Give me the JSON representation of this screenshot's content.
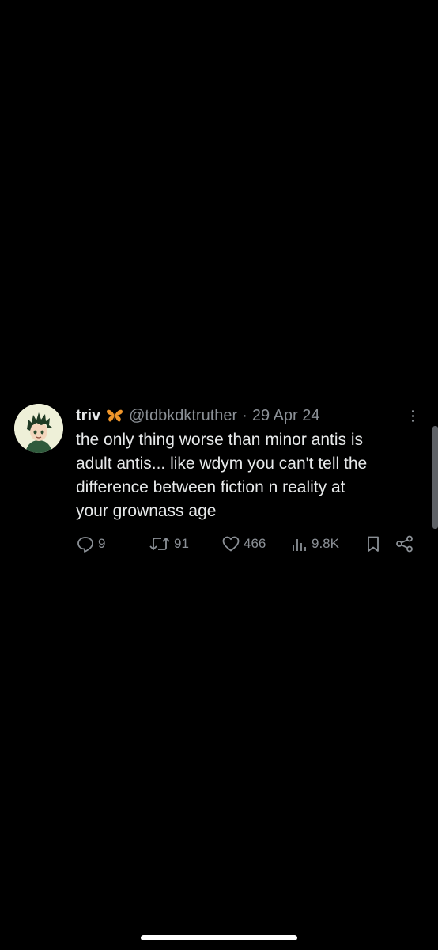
{
  "tweet": {
    "display_name": "triv",
    "emoji_icon": "butterfly-icon",
    "handle": "@tdbkdktruther",
    "separator": "·",
    "date": "29 Apr 24",
    "text": "the only thing worse than minor antis is\nadult antis... like wdym you can't tell the\ndifference between fiction n reality at\nyour grownass age",
    "stats": {
      "replies": "9",
      "retweets": "91",
      "likes": "466",
      "views": "9.8K"
    }
  },
  "colors": {
    "background": "#000000",
    "text": "#e7e9ea",
    "muted": "#8b9096",
    "divider": "#2f3336",
    "butterfly": "#f0962a"
  }
}
